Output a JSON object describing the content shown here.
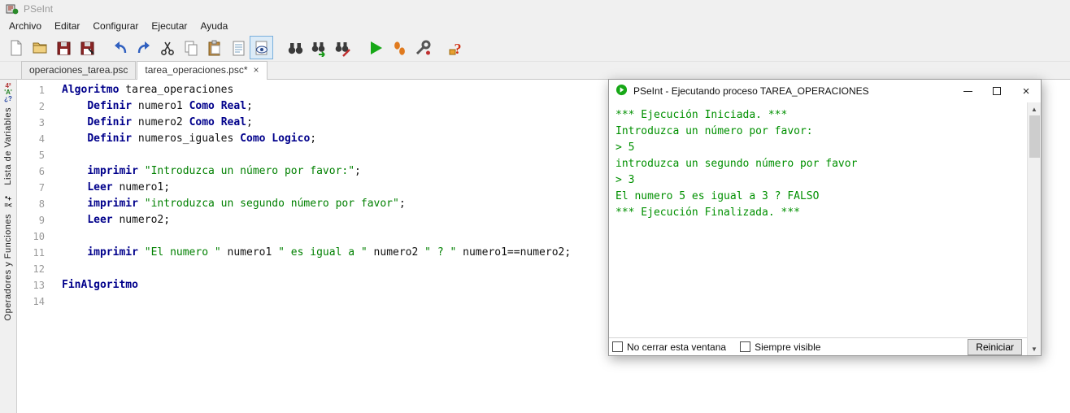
{
  "colors": {
    "keyword": "#00008b",
    "string": "#008000",
    "console_text": "#009000",
    "run_green": "#17a817",
    "selected_tool_border": "#7ab0dd"
  },
  "titlebar": {
    "title": "PSeInt"
  },
  "menu": {
    "items": [
      "Archivo",
      "Editar",
      "Configurar",
      "Ejecutar",
      "Ayuda"
    ]
  },
  "toolbar": {
    "icons": [
      {
        "name": "new-file",
        "group": 1
      },
      {
        "name": "open-file",
        "group": 1
      },
      {
        "name": "save",
        "group": 1
      },
      {
        "name": "save-as",
        "group": 1
      },
      {
        "name": "undo",
        "group": 2
      },
      {
        "name": "redo",
        "group": 2
      },
      {
        "name": "cut",
        "group": 2
      },
      {
        "name": "copy",
        "group": 2
      },
      {
        "name": "paste",
        "group": 2
      },
      {
        "name": "document-preview",
        "group": 2
      },
      {
        "name": "syntax-eye",
        "group": 2,
        "selected": true
      },
      {
        "name": "find",
        "group": 3
      },
      {
        "name": "find-next",
        "group": 3
      },
      {
        "name": "replace",
        "group": 3
      },
      {
        "name": "run",
        "group": 4
      },
      {
        "name": "run-step",
        "group": 4
      },
      {
        "name": "tools",
        "group": 4
      },
      {
        "name": "help",
        "group": 5
      }
    ]
  },
  "tabs": [
    {
      "label": "operaciones_tarea.psc",
      "active": false,
      "closable": false
    },
    {
      "label": "tarea_operaciones.psc*",
      "active": true,
      "closable": true
    }
  ],
  "sidebar": {
    "groups": [
      {
        "icon": "variables-icon",
        "label": "Lista de Variables"
      },
      {
        "icon": "operators-icon",
        "label": "Operadores y Funciones"
      }
    ]
  },
  "editor": {
    "lines": [
      {
        "n": "1",
        "s": [
          [
            "kw",
            "Algoritmo"
          ],
          [
            "pl",
            " tarea_operaciones"
          ]
        ]
      },
      {
        "n": "2",
        "s": [
          [
            "pl",
            "    "
          ],
          [
            "kw",
            "Definir"
          ],
          [
            "pl",
            " numero1 "
          ],
          [
            "kw",
            "Como Real"
          ],
          [
            "pl",
            ";"
          ]
        ]
      },
      {
        "n": "3",
        "s": [
          [
            "pl",
            "    "
          ],
          [
            "kw",
            "Definir"
          ],
          [
            "pl",
            " numero2 "
          ],
          [
            "kw",
            "Como Real"
          ],
          [
            "pl",
            ";"
          ]
        ]
      },
      {
        "n": "4",
        "s": [
          [
            "pl",
            "    "
          ],
          [
            "kw",
            "Definir"
          ],
          [
            "pl",
            " numeros_iguales "
          ],
          [
            "kw",
            "Como Logico"
          ],
          [
            "pl",
            ";"
          ]
        ]
      },
      {
        "n": "5",
        "s": []
      },
      {
        "n": "6",
        "s": [
          [
            "pl",
            "    "
          ],
          [
            "kw",
            "imprimir"
          ],
          [
            "pl",
            " "
          ],
          [
            "str",
            "\"Introduzca un número por favor:\""
          ],
          [
            "pl",
            ";"
          ]
        ]
      },
      {
        "n": "7",
        "s": [
          [
            "pl",
            "    "
          ],
          [
            "kw",
            "Leer"
          ],
          [
            "pl",
            " numero1;"
          ]
        ]
      },
      {
        "n": "8",
        "s": [
          [
            "pl",
            "    "
          ],
          [
            "kw",
            "imprimir"
          ],
          [
            "pl",
            " "
          ],
          [
            "str",
            "\"introduzca un segundo número por favor\""
          ],
          [
            "pl",
            ";"
          ]
        ]
      },
      {
        "n": "9",
        "s": [
          [
            "pl",
            "    "
          ],
          [
            "kw",
            "Leer"
          ],
          [
            "pl",
            " numero2;"
          ]
        ]
      },
      {
        "n": "10",
        "s": []
      },
      {
        "n": "11",
        "s": [
          [
            "pl",
            "    "
          ],
          [
            "kw",
            "imprimir"
          ],
          [
            "pl",
            " "
          ],
          [
            "str",
            "\"El numero \""
          ],
          [
            "pl",
            " numero1 "
          ],
          [
            "str",
            "\" es igual a \""
          ],
          [
            "pl",
            " numero2 "
          ],
          [
            "str",
            "\" ? \""
          ],
          [
            "pl",
            " numero1==numero2;"
          ]
        ]
      },
      {
        "n": "12",
        "s": []
      },
      {
        "n": "13",
        "s": [
          [
            "kw",
            "FinAlgoritmo"
          ]
        ]
      },
      {
        "n": "14",
        "s": []
      }
    ]
  },
  "console": {
    "title": "PSeInt - Ejecutando proceso TAREA_OPERACIONES",
    "lines": [
      "*** Ejecución Iniciada. ***",
      "Introduzca un número por favor:",
      "> 5",
      "introduzca un segundo número por favor",
      "> 3",
      "El numero 5 es igual a 3 ? FALSO",
      "*** Ejecución Finalizada. ***"
    ],
    "checkbox1": "No cerrar esta ventana",
    "checkbox2": "Siempre visible",
    "restart_button": "Reiniciar"
  }
}
